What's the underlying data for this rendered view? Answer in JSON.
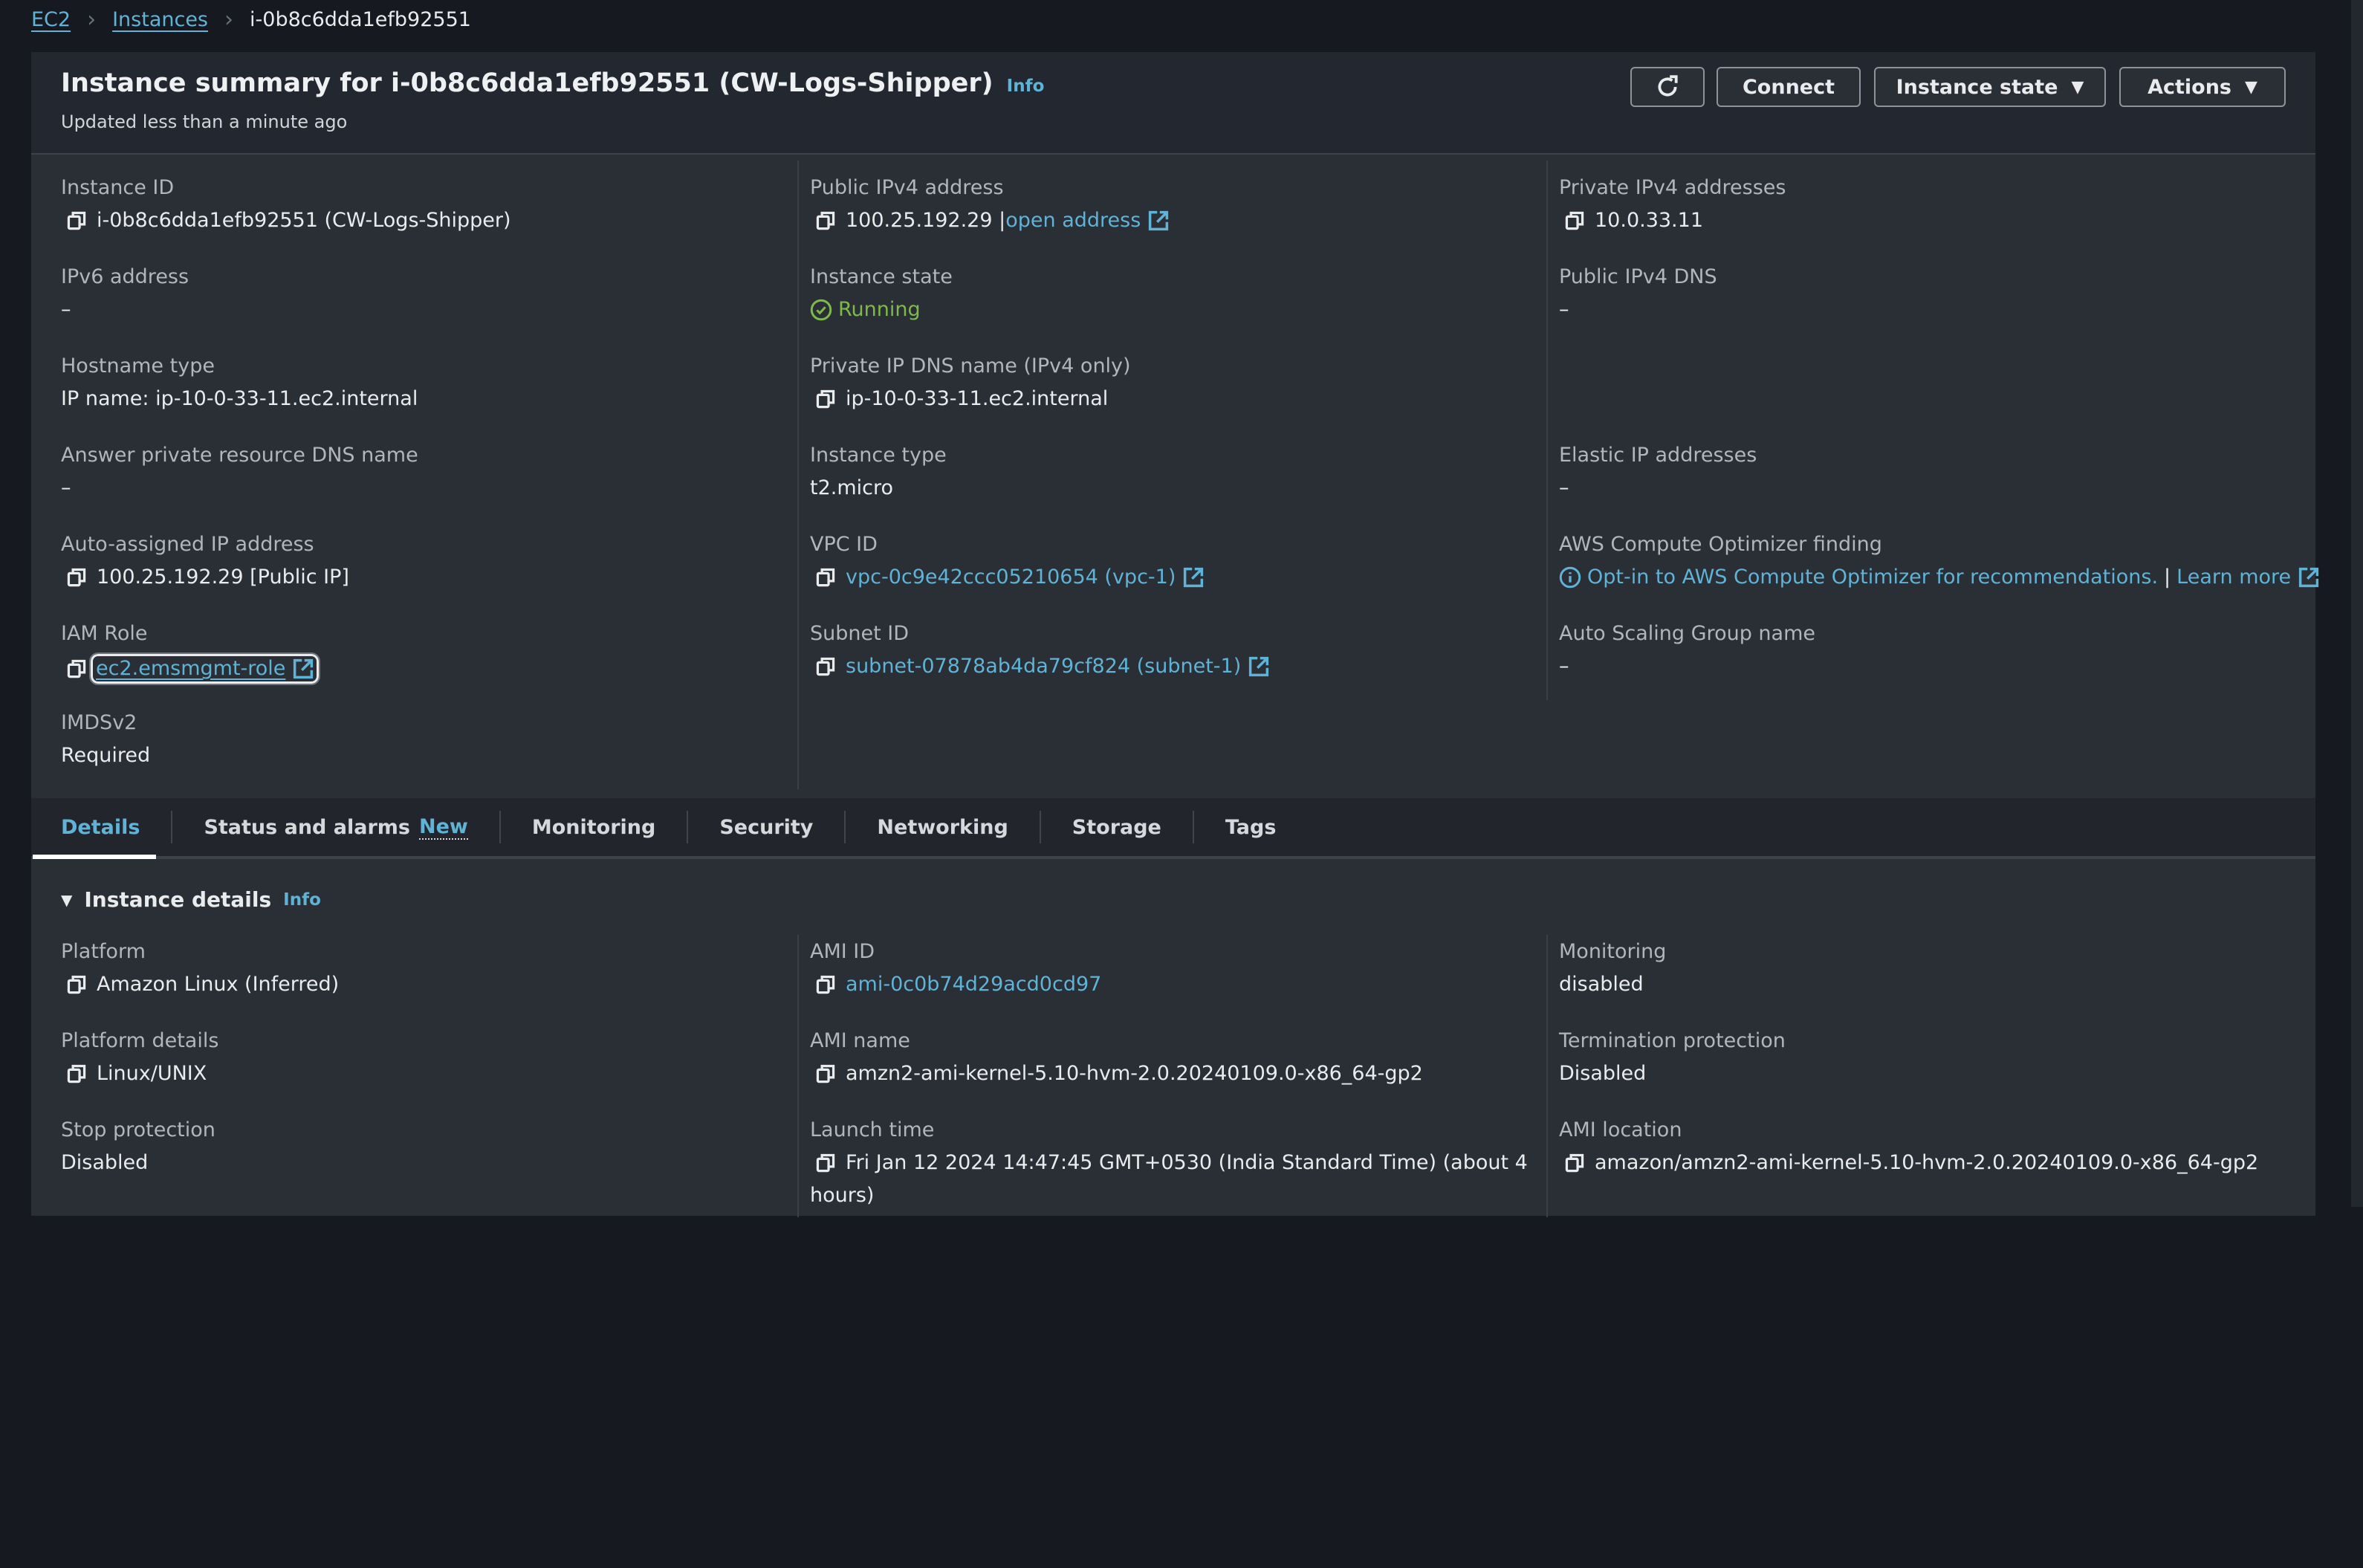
{
  "breadcrumb": {
    "root": "EC2",
    "parent": "Instances",
    "current": "i-0b8c6dda1efb92551"
  },
  "header": {
    "title": "Instance summary for i-0b8c6dda1efb92551 (CW-Logs-Shipper)",
    "info": "Info",
    "subtitle": "Updated less than a minute ago",
    "buttons": {
      "refresh": "refresh-icon",
      "connect": "Connect",
      "instance_state": "Instance state",
      "actions": "Actions"
    }
  },
  "summary": {
    "instance_id": {
      "label": "Instance ID",
      "value": "i-0b8c6dda1efb92551 (CW-Logs-Shipper)"
    },
    "ipv6": {
      "label": "IPv6 address",
      "value": "–"
    },
    "hostname_type": {
      "label": "Hostname type",
      "value": "IP name: ip-10-0-33-11.ec2.internal"
    },
    "answer_dns": {
      "label": "Answer private resource DNS name",
      "value": "–"
    },
    "auto_ip": {
      "label": "Auto-assigned IP address",
      "value": "100.25.192.29 [Public IP]"
    },
    "iam_role": {
      "label": "IAM Role",
      "value": "ec2.emsmgmt-role"
    },
    "imdsv2": {
      "label": "IMDSv2",
      "value": "Required"
    },
    "public_ipv4": {
      "label": "Public IPv4 address",
      "value": "100.25.192.29",
      "sep": "|",
      "link": "open address"
    },
    "instance_state": {
      "label": "Instance state",
      "value": "Running",
      "status_color": "#7dba4a"
    },
    "private_dns": {
      "label": "Private IP DNS name (IPv4 only)",
      "value": "ip-10-0-33-11.ec2.internal"
    },
    "instance_type": {
      "label": "Instance type",
      "value": "t2.micro"
    },
    "vpc_id": {
      "label": "VPC ID",
      "value": "vpc-0c9e42ccc05210654 (vpc-1)"
    },
    "subnet_id": {
      "label": "Subnet ID",
      "value": "subnet-07878ab4da79cf824 (subnet-1)"
    },
    "private_ipv4": {
      "label": "Private IPv4 addresses",
      "value": "10.0.33.11"
    },
    "public_dns": {
      "label": "Public IPv4 DNS",
      "value": "–"
    },
    "elastic_ip": {
      "label": "Elastic IP addresses",
      "value": "–"
    },
    "optimizer": {
      "label": "AWS Compute Optimizer finding",
      "value": "Opt-in to AWS Compute Optimizer for recommendations.",
      "sep": "|",
      "link": "Learn more"
    },
    "asg": {
      "label": "Auto Scaling Group name",
      "value": "–"
    }
  },
  "tabs": [
    {
      "label": "Details",
      "active": true
    },
    {
      "label": "Status and alarms",
      "badge": "New"
    },
    {
      "label": "Monitoring"
    },
    {
      "label": "Security"
    },
    {
      "label": "Networking"
    },
    {
      "label": "Storage"
    },
    {
      "label": "Tags"
    }
  ],
  "details": {
    "title": "Instance details",
    "info": "Info",
    "platform": {
      "label": "Platform",
      "value": "Amazon Linux (Inferred)"
    },
    "platform_details": {
      "label": "Platform details",
      "value": "Linux/UNIX"
    },
    "stop_protection": {
      "label": "Stop protection",
      "value": "Disabled"
    },
    "ami_id": {
      "label": "AMI ID",
      "value": "ami-0c0b74d29acd0cd97"
    },
    "ami_name": {
      "label": "AMI name",
      "value": "amzn2-ami-kernel-5.10-hvm-2.0.20240109.0-x86_64-gp2"
    },
    "launch_time": {
      "label": "Launch time",
      "value": "Fri Jan 12 2024 14:47:45 GMT+0530 (India Standard Time) (about 4",
      "value_cont": "hours)"
    },
    "monitoring": {
      "label": "Monitoring",
      "value": "disabled"
    },
    "termination_protection": {
      "label": "Termination protection",
      "value": "Disabled"
    },
    "ami_location": {
      "label": "AMI location",
      "value": "amazon/amzn2-ami-kernel-5.10-hvm-2.0.20240109.0-x86_64-gp2"
    }
  },
  "colors": {
    "link": "#5fb3d6",
    "running": "#7dba4a",
    "panel": "#2a2e35",
    "header": "#232730",
    "page": "#16191f"
  }
}
